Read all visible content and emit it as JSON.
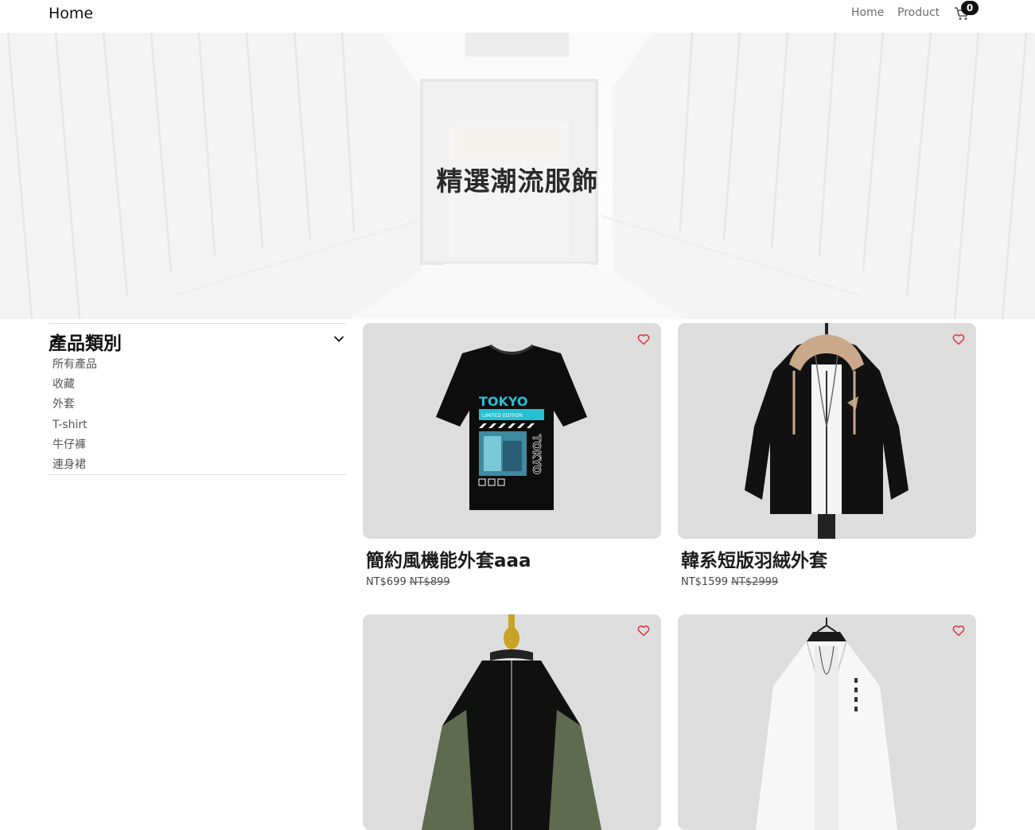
{
  "navbar": {
    "brand": "Home",
    "links": [
      "Home",
      "Product"
    ],
    "cart_count": "0",
    "cart_icon": "cart-icon"
  },
  "hero": {
    "title": "精選潮流服飾"
  },
  "sidebar": {
    "title": "產品類別",
    "toggle_icon": "chevron-down-icon",
    "categories": [
      "所有產品",
      "收藏",
      "外套",
      "T-shirt",
      "牛仔褲",
      "連身裙"
    ]
  },
  "products": [
    {
      "name": "簡約風機能外套aaa",
      "price": "NT$699",
      "original_price": "NT$899"
    },
    {
      "name": "韓系短版羽絨外套",
      "price": "NT$1599",
      "original_price": "NT$2999"
    },
    {
      "name": "",
      "price": "",
      "original_price": ""
    },
    {
      "name": "",
      "price": "",
      "original_price": ""
    }
  ],
  "tshirt_print": {
    "headline": "TOKYO",
    "band": "LIMITED EDITION",
    "vertical": "TOKYO"
  },
  "colors": {
    "accent_heart": "#d9363e",
    "card_bg": "#dddddd",
    "tshirt_cyan": "#26c0d3"
  }
}
